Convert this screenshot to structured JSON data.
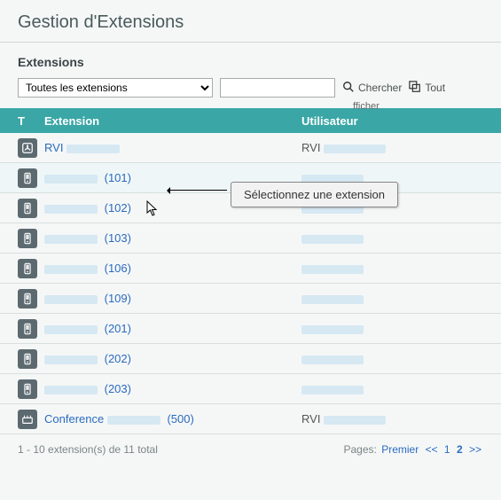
{
  "header": {
    "title": "Gestion d'Extensions"
  },
  "section": {
    "title": "Extensions"
  },
  "toolbar": {
    "filter_selected": "Toutes les extensions",
    "search_value": "",
    "afficher_label": "fficher",
    "search_button": "Chercher",
    "all_button": "Tout"
  },
  "columns": {
    "type": "T",
    "extension": "Extension",
    "user": "Utilisateur"
  },
  "rows": [
    {
      "type": "ivr",
      "ext_label": "RVI",
      "num": "",
      "user": "RVI"
    },
    {
      "type": "phone",
      "ext_label": "",
      "num": "(101)",
      "user": ""
    },
    {
      "type": "phone",
      "ext_label": "",
      "num": "(102)",
      "user": ""
    },
    {
      "type": "phone",
      "ext_label": "",
      "num": "(103)",
      "user": ""
    },
    {
      "type": "phone",
      "ext_label": "",
      "num": "(106)",
      "user": ""
    },
    {
      "type": "phone",
      "ext_label": "",
      "num": "(109)",
      "user": ""
    },
    {
      "type": "phone",
      "ext_label": "",
      "num": "(201)",
      "user": ""
    },
    {
      "type": "phone",
      "ext_label": "",
      "num": "(202)",
      "user": ""
    },
    {
      "type": "phone",
      "ext_label": "",
      "num": "(203)",
      "user": ""
    },
    {
      "type": "conf",
      "ext_label": "Conference",
      "num": "(500)",
      "user": "RVI"
    }
  ],
  "tooltip": "Sélectionnez une extension",
  "footer": {
    "count_text": "1 - 10 extension(s) de 11 total",
    "pages_label": "Pages:",
    "first": "Premier",
    "prev": "<<",
    "p1": "1",
    "p2": "2",
    "next": ">>"
  }
}
